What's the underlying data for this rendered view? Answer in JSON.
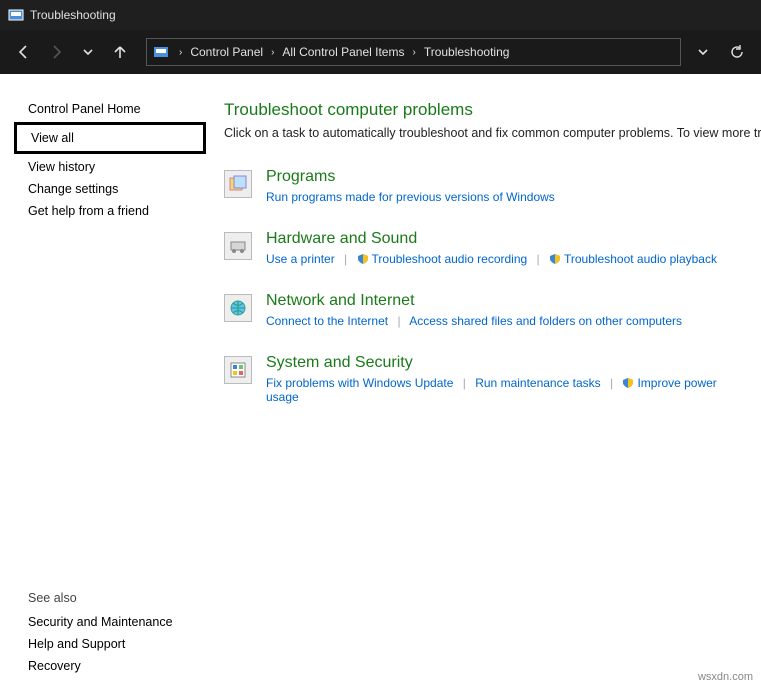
{
  "window": {
    "title": "Troubleshooting"
  },
  "breadcrumb": {
    "p0": "Control Panel",
    "p1": "All Control Panel Items",
    "p2": "Troubleshooting"
  },
  "sidebar": {
    "home": "Control Panel Home",
    "view_all": "View all",
    "view_history": "View history",
    "change_settings": "Change settings",
    "get_help": "Get help from a friend",
    "see_also_h": "See also",
    "see_also": {
      "sec": "Security and Maintenance",
      "help": "Help and Support",
      "rec": "Recovery"
    }
  },
  "main": {
    "heading": "Troubleshoot computer problems",
    "lead": "Click on a task to automatically troubleshoot and fix common computer problems. To view more troubleshooters",
    "cats": {
      "programs": {
        "title": "Programs",
        "l0": "Run programs made for previous versions of Windows"
      },
      "hw": {
        "title": "Hardware and Sound",
        "l0": "Use a printer",
        "l1": "Troubleshoot audio recording",
        "l2": "Troubleshoot audio playback"
      },
      "net": {
        "title": "Network and Internet",
        "l0": "Connect to the Internet",
        "l1": "Access shared files and folders on other computers"
      },
      "sys": {
        "title": "System and Security",
        "l0": "Fix problems with Windows Update",
        "l1": "Run maintenance tasks",
        "l2": "Improve power usage"
      }
    }
  },
  "watermark": "wsxdn.com"
}
